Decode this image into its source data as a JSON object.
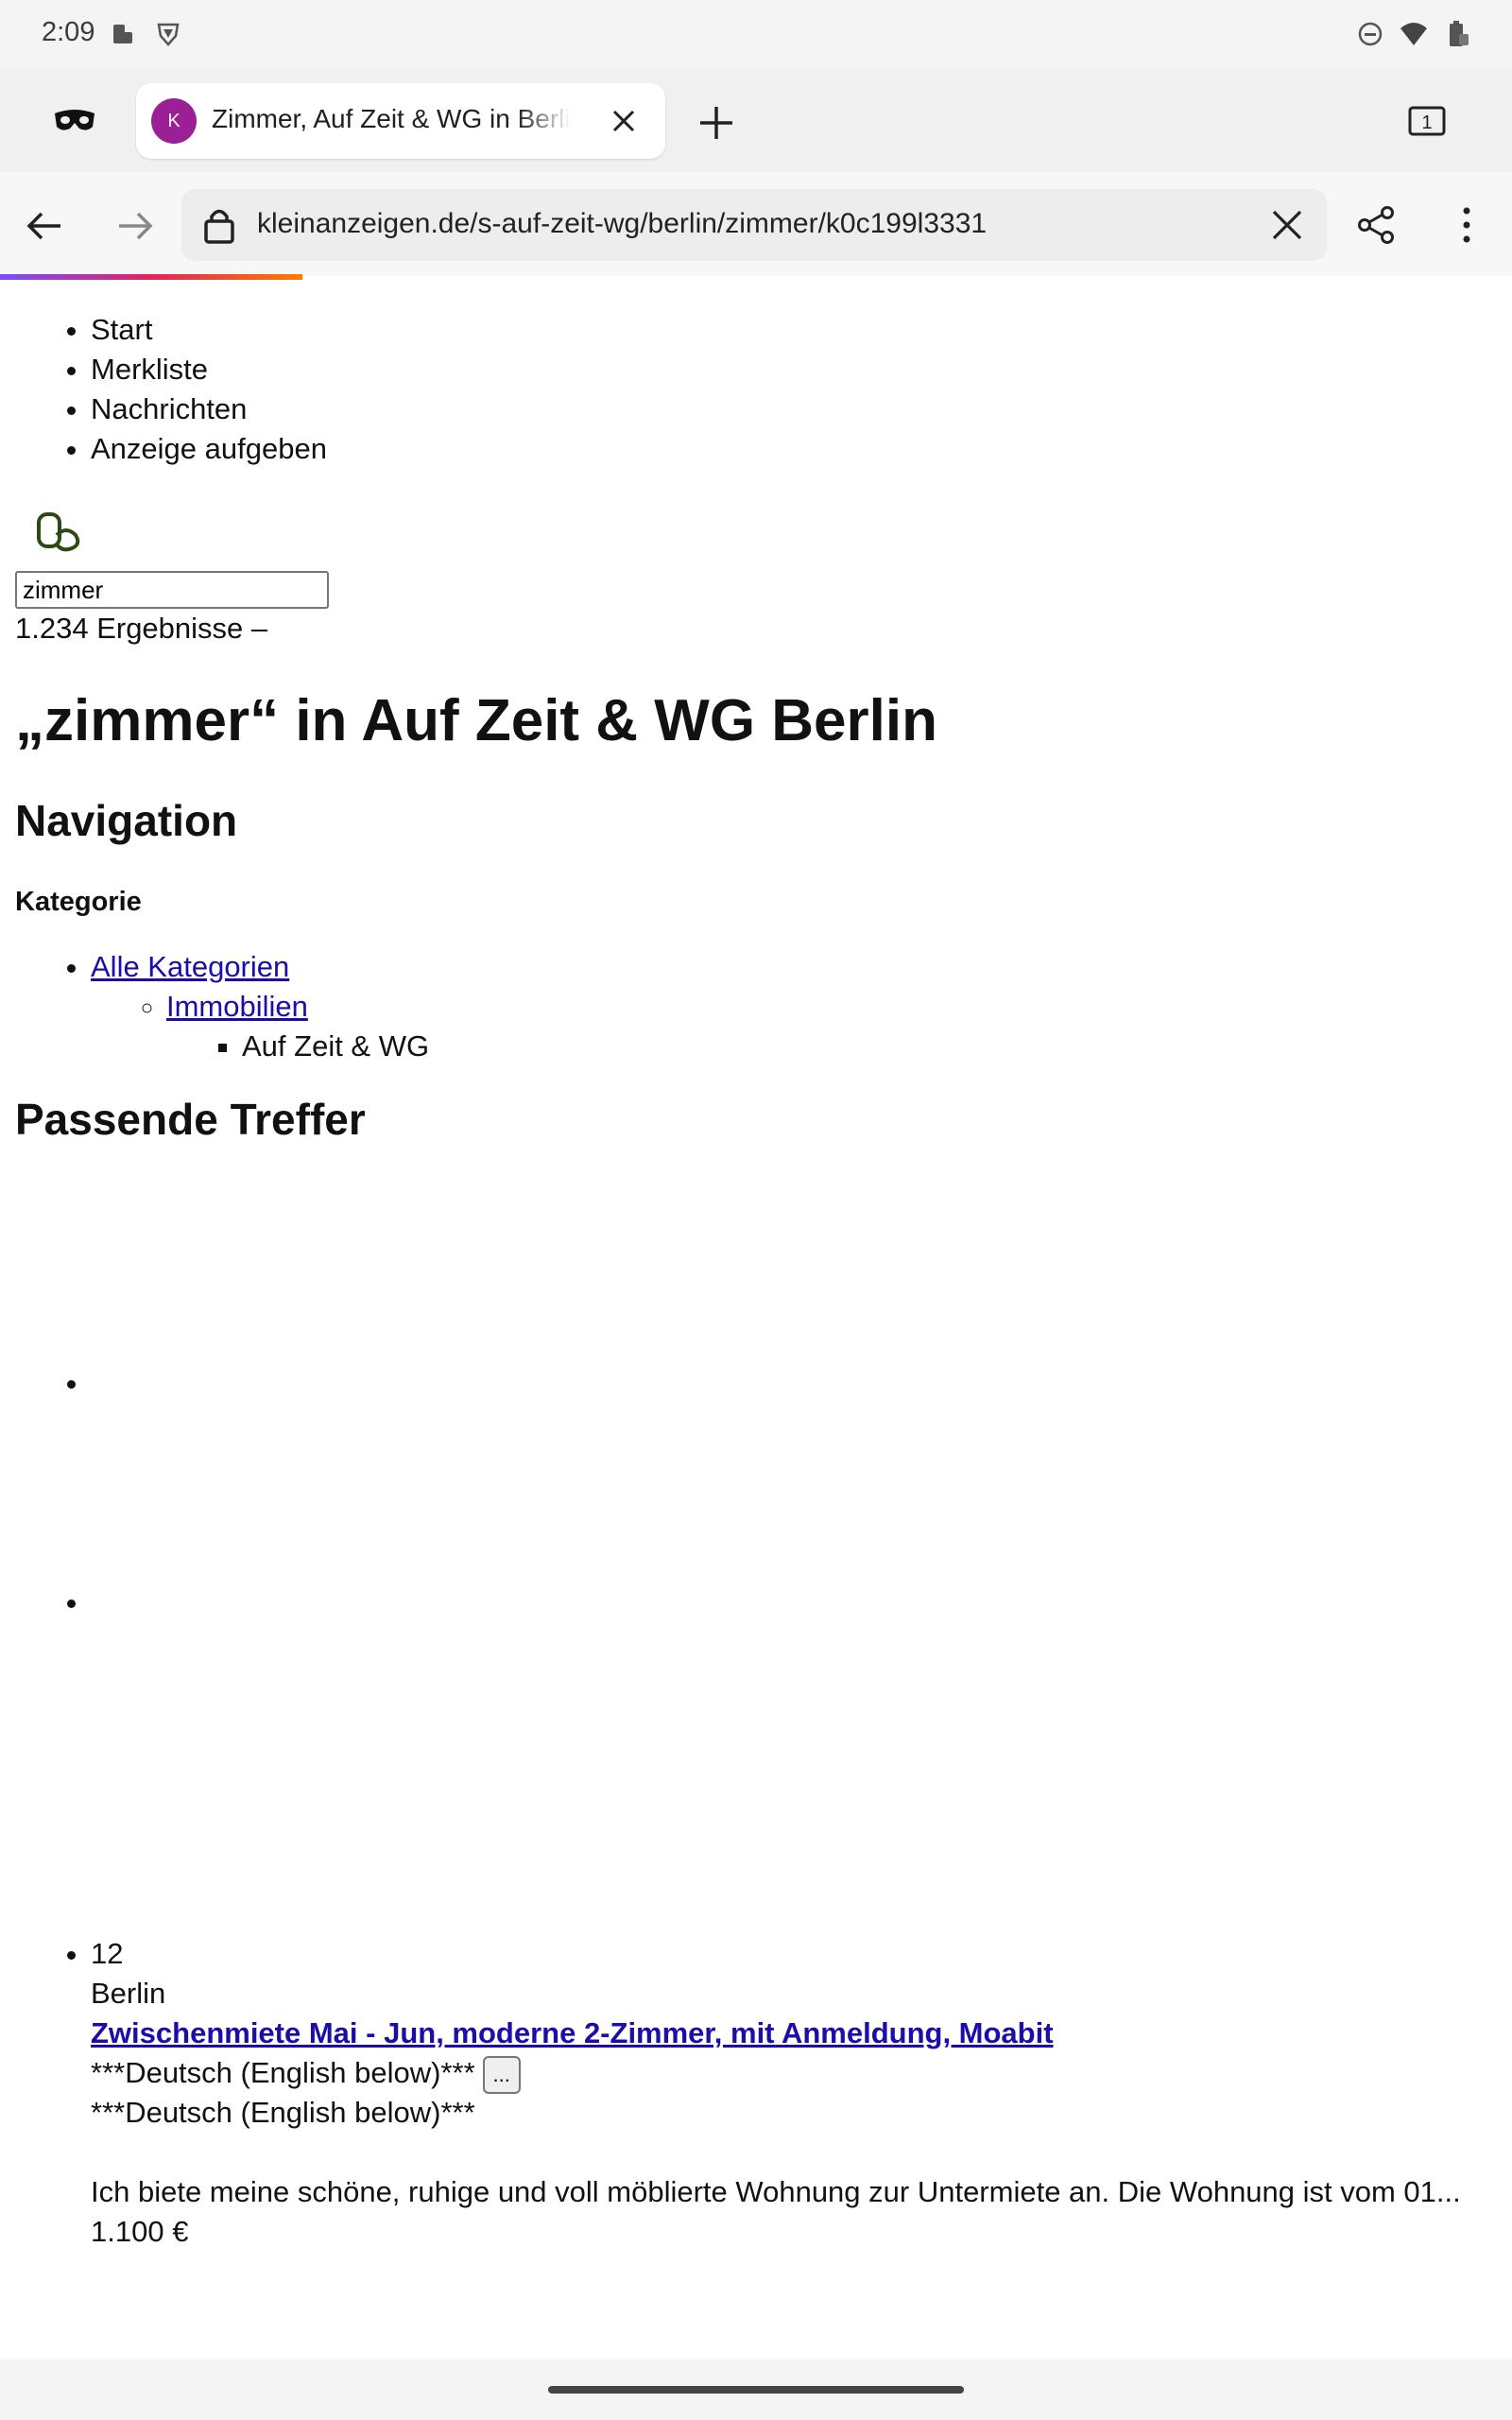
{
  "status_bar": {
    "time": "2:09",
    "left_icons": [
      "notification-app-icon",
      "shield-app-icon"
    ],
    "right_icons": [
      "do-not-disturb-icon",
      "wifi-icon",
      "battery-icon"
    ]
  },
  "tabs": {
    "active_tab": {
      "favicon_letter": "K",
      "title": "Zimmer, Auf Zeit & WG in Berlin"
    },
    "count": "1"
  },
  "toolbar": {
    "url": "kleinanzeigen.de/s-auf-zeit-wg/berlin/zimmer/k0c199l3331",
    "load_progress": 0.25
  },
  "page": {
    "top_nav": [
      "Start",
      "Merkliste",
      "Nachrichten",
      "Anzeige aufgeben"
    ],
    "search": {
      "value": "zimmer"
    },
    "result_count": "1.234 Ergebnisse –",
    "heading": "„zimmer“ in Auf Zeit & WG Berlin",
    "navigation_heading": "Navigation",
    "category_heading": "Kategorie",
    "categories": {
      "level1": "Alle Kategorien",
      "level2": "Immobilien",
      "level3": "Auf Zeit & WG"
    },
    "results_heading": "Passende Treffer",
    "listing": {
      "image_count": "12",
      "location": "Berlin",
      "title": "Zwischenmiete Mai - Jun, moderne 2-Zimmer, mit Anmeldung, Moabit",
      "teaser": "***Deutsch (English below)***",
      "more_button": "...",
      "desc_line1": "***Deutsch (English below)***",
      "desc_line2": "Ich biete meine schöne, ruhige und voll möblierte Wohnung zur Untermiete an. Die Wohnung ist vom 01...",
      "price": "1.100 €"
    }
  },
  "colors": {
    "link": "#1a0dab",
    "favicon": "#9b1f97",
    "logo": "#2c4a13"
  }
}
